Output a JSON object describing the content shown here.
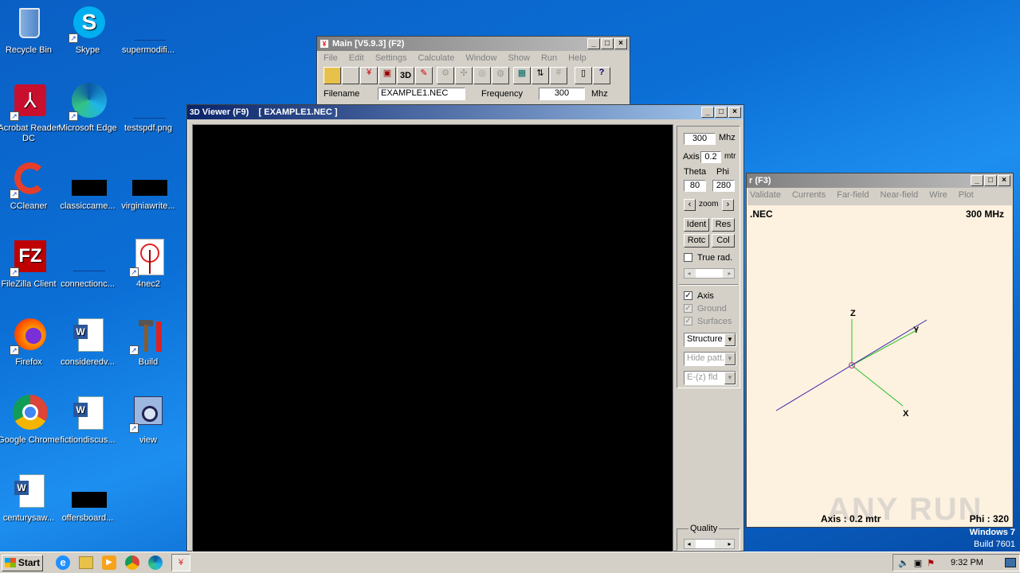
{
  "desktop": {
    "icons": [
      {
        "label": "Recycle Bin"
      },
      {
        "label": "Skype"
      },
      {
        "label": "supermodifi..."
      },
      {
        "label": "Acrobat Reader DC"
      },
      {
        "label": "Microsoft Edge"
      },
      {
        "label": "testspdf.png"
      },
      {
        "label": "CCleaner"
      },
      {
        "label": "classiccame..."
      },
      {
        "label": "virginiawrite..."
      },
      {
        "label": "FileZilla Client"
      },
      {
        "label": "connectionc..."
      },
      {
        "label": "4nec2"
      },
      {
        "label": "Firefox"
      },
      {
        "label": "consideredv..."
      },
      {
        "label": "Build"
      },
      {
        "label": "Google Chrome"
      },
      {
        "label": "fictiondiscus..."
      },
      {
        "label": "view"
      },
      {
        "label": "centurysaw..."
      },
      {
        "label": "offersboard..."
      }
    ]
  },
  "main_window": {
    "title": "Main [V5.9.3]  (F2)",
    "menu": [
      "File",
      "Edit",
      "Settings",
      "Calculate",
      "Window",
      "Show",
      "Run",
      "Help"
    ],
    "filename_label": "Filename",
    "filename_value": "EXAMPLE1.NEC",
    "frequency_label": "Frequency",
    "frequency_value": "300",
    "frequency_unit": "Mhz",
    "toolbar_3d": "3D"
  },
  "viewer_window": {
    "title": "Viewer (F9)    [ EXAMPLE1.NEC ]",
    "freq_value": "300",
    "freq_unit": "Mhz",
    "axis_label": "Axis",
    "axis_value": "0.2",
    "axis_unit": "mtr",
    "theta_label": "Theta",
    "phi_label": "Phi",
    "theta_value": "80",
    "phi_value": "280",
    "zoom_label": "zoom",
    "ident": "Ident",
    "res": "Res",
    "rotc": "Rotc",
    "col": "Col",
    "true_rad": "True rad.",
    "axis_check": "Axis",
    "ground_check": "Ground",
    "surfaces_check": "Surfaces",
    "select1": "Structure",
    "select2": "Hide patt.",
    "select3": "E-(z) fld",
    "quality": "Quality"
  },
  "geometry_window": {
    "title": "r  (F3)",
    "menu": [
      "Validate",
      "Currents",
      "Far-field",
      "Near-field",
      "Wire",
      "Plot"
    ],
    "file_label": ".NEC",
    "freq_label": "300 MHz",
    "axis_info": "Axis : 0.2 mtr",
    "phi_info": "Phi : 320",
    "axis_z": "Z",
    "axis_y": "Y",
    "axis_x": "X",
    "watermark": "ANY RUN"
  },
  "os_badge": {
    "line1": "Windows 7",
    "line2": "Build 7601"
  },
  "taskbar": {
    "start": "Start",
    "clock": "9:32 PM"
  }
}
